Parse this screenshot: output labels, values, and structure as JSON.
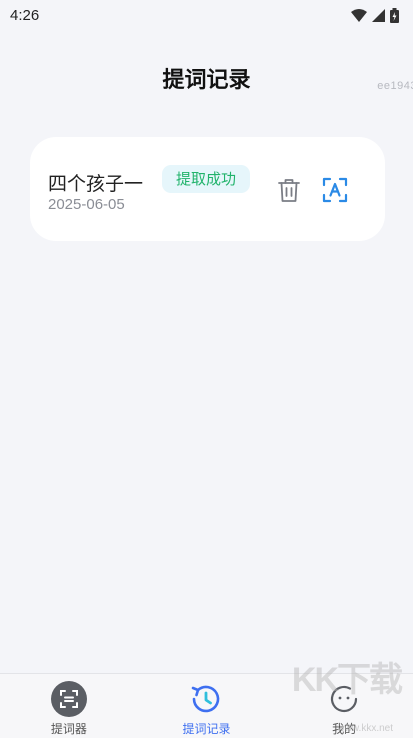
{
  "status_bar": {
    "time": "4:26"
  },
  "watermark_id": "ee1943",
  "page": {
    "title": "提词记录"
  },
  "records": [
    {
      "title": "四个孩子一",
      "status": "提取成功",
      "date": "2025-06-05"
    }
  ],
  "tabs": [
    {
      "label": "提词器",
      "icon": "teleprompter-icon",
      "active": false
    },
    {
      "label": "提词记录",
      "icon": "history-clock-icon",
      "active": true
    },
    {
      "label": "我的",
      "icon": "profile-face-icon",
      "active": false
    }
  ],
  "watermark": {
    "logo": "KK下载",
    "url": "www.kkx.net"
  },
  "colors": {
    "background": "#f4f5f9",
    "card": "#ffffff",
    "badge_bg": "#e6f6fb",
    "badge_text": "#21b36b",
    "accent": "#3e6ff0",
    "extract_icon": "#2b8ae6"
  }
}
